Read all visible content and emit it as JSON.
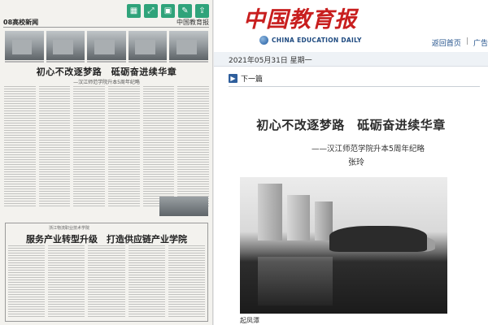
{
  "scan": {
    "section_label": "08高校新闻",
    "masthead": "中国教育报",
    "headline_main": "初心不改逐梦路　砥砺奋进续华章",
    "headline_sub": "—汉江师范学院升本5周年纪略",
    "box_label": "浙江物流职业技术学院",
    "headline_second": "服务产业转型升级　打造供应链产业学院"
  },
  "toolbar": {
    "buttons": [
      {
        "name": "grid-icon",
        "glyph": "▦"
      },
      {
        "name": "expand-icon",
        "glyph": "⤢"
      },
      {
        "name": "save-icon",
        "glyph": "▣"
      },
      {
        "name": "edit-icon",
        "glyph": "✎"
      },
      {
        "name": "share-icon",
        "glyph": "⇪"
      }
    ]
  },
  "brand": {
    "logo_cn": "中国教育报",
    "logo_en": "CHINA EDUCATION DAILY"
  },
  "links": {
    "home": "返回首页",
    "divider": "|",
    "ad": "广告"
  },
  "date_text": "2021年05月31日  星期一",
  "nav": {
    "next_label": "下一篇",
    "arrow_glyph": "▶"
  },
  "article": {
    "title": "初心不改逐梦路　砥砺奋进续华章",
    "subtitle": "——汉江师范学院升本5周年纪略",
    "author": "张玲",
    "photo_caption": "起凤潭"
  },
  "colors": {
    "logo_red": "#c81e1e",
    "link_blue": "#1f4f8a",
    "toolbar_green": "#2fa37a"
  }
}
